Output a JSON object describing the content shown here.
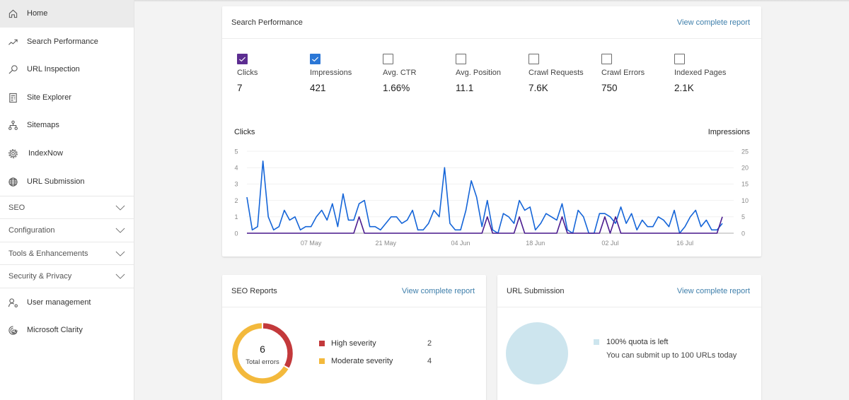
{
  "sidebar": {
    "nav_items": [
      {
        "label": "Home",
        "icon": "home-icon",
        "active": true
      },
      {
        "label": "Search Performance",
        "icon": "trend-icon"
      },
      {
        "label": "URL Inspection",
        "icon": "search-icon"
      },
      {
        "label": "Site Explorer",
        "icon": "site-explorer-icon"
      },
      {
        "label": "Sitemaps",
        "icon": "sitemap-icon"
      },
      {
        "label": "IndexNow",
        "icon": "indexnow-icon"
      },
      {
        "label": "URL Submission",
        "icon": "globe-icon"
      }
    ],
    "sections": [
      {
        "label": "SEO",
        "expanded": false
      },
      {
        "label": "Configuration",
        "expanded": false
      },
      {
        "label": "Tools & Enhancements",
        "expanded": false
      },
      {
        "label": "Security & Privacy",
        "expanded": false
      }
    ],
    "bottom_items": [
      {
        "label": "User management",
        "icon": "user-management-icon"
      },
      {
        "label": "Microsoft Clarity",
        "icon": "clarity-icon"
      }
    ]
  },
  "search_performance": {
    "title": "Search Performance",
    "link": "View complete report",
    "metrics": [
      {
        "label": "Clicks",
        "value": "7",
        "checked": true,
        "color": "#5c2d91"
      },
      {
        "label": "Impressions",
        "value": "421",
        "checked": true,
        "color": "#2b77d6"
      },
      {
        "label": "Avg. CTR",
        "value": "1.66%",
        "checked": false
      },
      {
        "label": "Avg. Position",
        "value": "11.1",
        "checked": false
      },
      {
        "label": "Crawl Requests",
        "value": "7.6K",
        "checked": false
      },
      {
        "label": "Crawl Errors",
        "value": "750",
        "checked": false
      },
      {
        "label": "Indexed Pages",
        "value": "2.1K",
        "checked": false
      }
    ]
  },
  "seo_reports": {
    "title": "SEO Reports",
    "link": "View complete report"
  },
  "url_submission": {
    "title": "URL Submission",
    "link": "View complete report"
  },
  "chart_data": [
    {
      "type": "line",
      "title": "",
      "ylabel": "Clicks",
      "y2label": "Impressions",
      "ylim": [
        0,
        5
      ],
      "y2lim": [
        0,
        25
      ],
      "yticks": [
        "0",
        "1",
        "2",
        "3",
        "4",
        "5"
      ],
      "y2ticks": [
        "0",
        "5",
        "10",
        "15",
        "20",
        "25"
      ],
      "xtick_labels": [
        "07 May",
        "21 May",
        "04 Jun",
        "18 Jun",
        "02 Jul",
        "16 Jul"
      ],
      "grid": true,
      "legend": "none",
      "x": [
        "25 Apr",
        "26 Apr",
        "27 Apr",
        "28 Apr",
        "29 Apr",
        "30 Apr",
        "01 May",
        "02 May",
        "03 May",
        "04 May",
        "05 May",
        "06 May",
        "07 May",
        "08 May",
        "09 May",
        "10 May",
        "11 May",
        "12 May",
        "13 May",
        "14 May",
        "15 May",
        "16 May",
        "17 May",
        "18 May",
        "19 May",
        "20 May",
        "21 May",
        "22 May",
        "23 May",
        "24 May",
        "25 May",
        "26 May",
        "27 May",
        "28 May",
        "29 May",
        "30 May",
        "31 May",
        "01 Jun",
        "02 Jun",
        "03 Jun",
        "04 Jun",
        "05 Jun",
        "06 Jun",
        "07 Jun",
        "08 Jun",
        "09 Jun",
        "10 Jun",
        "11 Jun",
        "12 Jun",
        "13 Jun",
        "14 Jun",
        "15 Jun",
        "16 Jun",
        "17 Jun",
        "18 Jun",
        "19 Jun",
        "20 Jun",
        "21 Jun",
        "22 Jun",
        "23 Jun",
        "24 Jun",
        "25 Jun",
        "26 Jun",
        "27 Jun",
        "28 Jun",
        "29 Jun",
        "30 Jun",
        "01 Jul",
        "02 Jul",
        "03 Jul",
        "04 Jul",
        "05 Jul",
        "06 Jul",
        "07 Jul",
        "08 Jul",
        "09 Jul",
        "10 Jul",
        "11 Jul",
        "12 Jul",
        "13 Jul",
        "14 Jul",
        "15 Jul",
        "16 Jul",
        "17 Jul",
        "18 Jul",
        "19 Jul",
        "20 Jul",
        "21 Jul",
        "22 Jul",
        "23 Jul"
      ],
      "series": [
        {
          "name": "Impressions",
          "axis": "right",
          "color": "#1565d8",
          "values": [
            11,
            1,
            2,
            22,
            5,
            1,
            2,
            7,
            4,
            5,
            1,
            2,
            2,
            5,
            7,
            4,
            9,
            2,
            12,
            4,
            4,
            9,
            10,
            2,
            2,
            1,
            3,
            5,
            5,
            3,
            4,
            7,
            1,
            1,
            3,
            7,
            5,
            20,
            3,
            1,
            1,
            7,
            16,
            11,
            2,
            10,
            1,
            0,
            6,
            5,
            3,
            10,
            7,
            8,
            1,
            3,
            6,
            5,
            4,
            9,
            1,
            0,
            7,
            5,
            0,
            0,
            6,
            6,
            5,
            3,
            8,
            3,
            6,
            1,
            4,
            2,
            2,
            5,
            4,
            2,
            7,
            0,
            2,
            5,
            7,
            2,
            4,
            1,
            1,
            3
          ]
        },
        {
          "name": "Clicks",
          "axis": "left",
          "color": "#4b1c8f",
          "values": [
            0,
            0,
            0,
            0,
            0,
            0,
            0,
            0,
            0,
            0,
            0,
            0,
            0,
            0,
            0,
            0,
            0,
            0,
            0,
            0,
            0,
            1,
            0,
            0,
            0,
            0,
            0,
            0,
            0,
            0,
            0,
            0,
            0,
            0,
            0,
            0,
            0,
            0,
            0,
            0,
            0,
            0,
            0,
            0,
            0,
            1,
            0,
            0,
            0,
            0,
            0,
            1,
            0,
            0,
            0,
            0,
            0,
            0,
            0,
            1,
            0,
            0,
            0,
            0,
            0,
            0,
            0,
            1,
            0,
            1,
            0,
            0,
            0,
            0,
            0,
            0,
            0,
            0,
            0,
            0,
            0,
            0,
            0,
            0,
            0,
            0,
            0,
            0,
            0,
            1
          ]
        }
      ]
    },
    {
      "type": "pie",
      "subtype": "donut",
      "center_value": "6",
      "center_label": "Total errors",
      "categories": [
        "High severity",
        "Moderate severity"
      ],
      "values": [
        2,
        4
      ],
      "colors": [
        "#c3393b",
        "#f3b93c"
      ]
    },
    {
      "type": "pie",
      "categories": [
        "100% quota is left"
      ],
      "values": [
        100
      ],
      "colors": [
        "#cde5ee"
      ],
      "note": "You can submit up to 100 URLs today"
    }
  ]
}
